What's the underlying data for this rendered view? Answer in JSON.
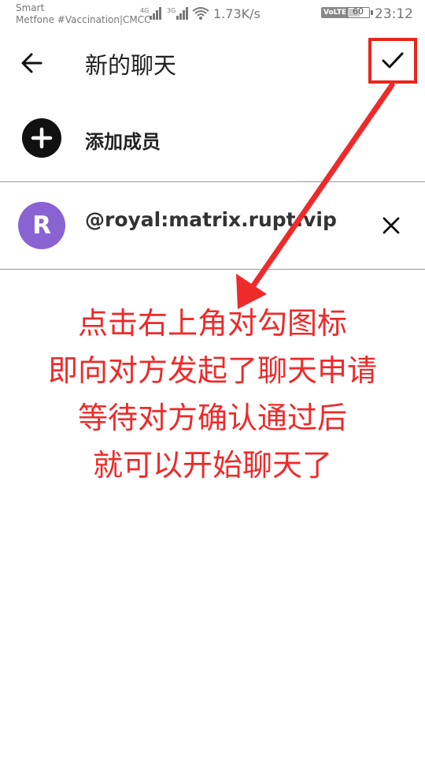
{
  "status_bar": {
    "carrier_line1": "Smart",
    "carrier_line2": "Metfone #Vaccination|CMCC",
    "net1": "4G",
    "net2": "3G",
    "speed": "1.73K/s",
    "volte": "VoLTE",
    "battery": "60",
    "battery_level": 0.6,
    "time": "23:12"
  },
  "app_bar": {
    "back_icon": "arrow-left-icon",
    "title": "新的聊天",
    "confirm_icon": "check-icon"
  },
  "add_member": {
    "icon": "plus-circle-icon",
    "label": "添加成员"
  },
  "members": [
    {
      "avatar_letter": "R",
      "avatar_color": "#8a63d2",
      "id": "@royal:matrix.rupt.vip",
      "remove_icon": "close-icon"
    }
  ],
  "annotation": {
    "color": "#ee2a2a",
    "lines": [
      "点击右上角对勾图标",
      "即向对方发起了聊天申请",
      "等待对方确认通过后",
      "就可以开始聊天了"
    ]
  }
}
